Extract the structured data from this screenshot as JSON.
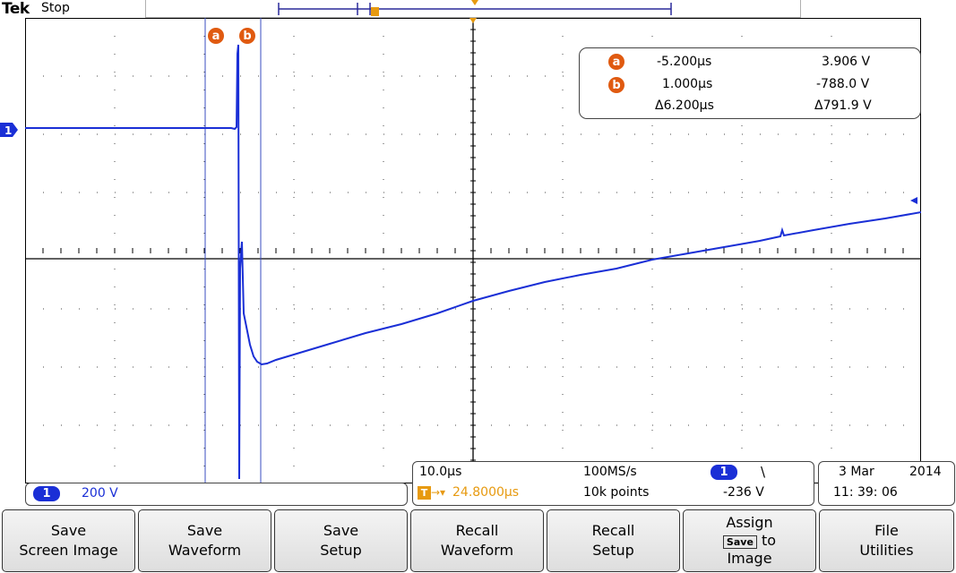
{
  "header": {
    "brand": "Tek",
    "acq_state": "Stop"
  },
  "trigger_marker": "T",
  "cursors": {
    "a_label": "a",
    "b_label": "b"
  },
  "readout": {
    "a_time": "-5.200µs",
    "a_volt": "3.906 V",
    "b_time": "1.000µs",
    "b_volt": "-788.0 V",
    "delta_time": "Δ6.200µs",
    "delta_volt": "Δ791.9 V"
  },
  "channel1": {
    "id": "1",
    "scale": "200 V",
    "color": "#1a2fd6"
  },
  "timebase": {
    "scale": "10.0µs",
    "sample_rate": "100MS/s",
    "trigger_position": "24.8000µs",
    "trigger_prefix": "T",
    "record_length": "10k points"
  },
  "trigger": {
    "source": "1",
    "slope_symbol": "\\",
    "level": "-236 V"
  },
  "datetime": {
    "date": "3 Mar",
    "year": "2014",
    "time": "11: 39: 06"
  },
  "menu": {
    "save_screen_image": [
      "Save",
      "Screen Image"
    ],
    "save_waveform": [
      "Save",
      "Waveform"
    ],
    "save_setup": [
      "Save",
      "Setup"
    ],
    "recall_waveform": [
      "Recall",
      "Waveform"
    ],
    "recall_setup": [
      "Recall",
      "Setup"
    ],
    "assign_top": "Assign",
    "assign_chip": "Save",
    "assign_to": "to",
    "assign_bottom": "Image",
    "file_utilities": [
      "File",
      "Utilities"
    ]
  },
  "colors": {
    "trace": "#1a2fd6",
    "cursor": "#3a4ec0",
    "accent": "#e05a10"
  }
}
